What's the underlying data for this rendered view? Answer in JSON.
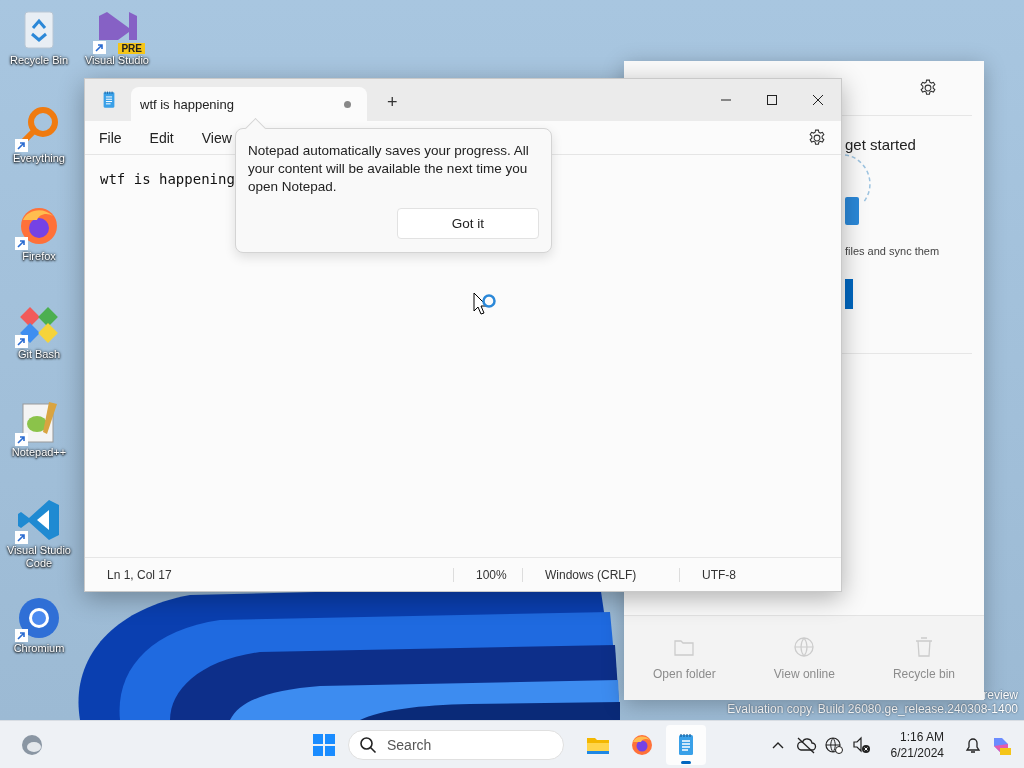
{
  "desktop_icons": [
    {
      "label": "Recycle Bin",
      "kind": "recycle",
      "shortcut": false
    },
    {
      "label": "Everything",
      "kind": "everything",
      "shortcut": true
    },
    {
      "label": "Firefox",
      "kind": "firefox",
      "shortcut": true
    },
    {
      "label": "Git Bash",
      "kind": "git",
      "shortcut": true
    },
    {
      "label": "Notepad++",
      "kind": "notepadpp",
      "shortcut": true
    },
    {
      "label": "Visual Studio Code",
      "kind": "vscode",
      "shortcut": true
    },
    {
      "label": "Chromium",
      "kind": "chromium",
      "shortcut": true
    },
    {
      "label": "Visual Studio",
      "kind": "vs",
      "shortcut": true,
      "badge": "PRE"
    }
  ],
  "system_watermark": [
    "review",
    "Evaluation copy. Build 26080.ge_release.240308-1400"
  ],
  "onedrive_panel": {
    "heading": "get started",
    "description": "files and sync them",
    "actions": [
      {
        "label": "Open folder",
        "kind": "folder",
        "disabled": true
      },
      {
        "label": "View online",
        "kind": "globe",
        "disabled": true
      },
      {
        "label": "Recycle bin",
        "kind": "bin",
        "disabled": true
      }
    ]
  },
  "notepad": {
    "tabs": [
      {
        "title": "wtf is happening",
        "selected": true,
        "unsaved": true
      }
    ],
    "new_tab": "+",
    "menu": [
      "File",
      "Edit",
      "View"
    ],
    "content": "wtf is happening",
    "status": [
      "Ln 1, Col 17",
      "100%",
      "Windows (CRLF)",
      "UTF-8"
    ]
  },
  "teaching_tip": {
    "message": "Notepad automatically saves your progress. All your content will be available the next time you open Notepad.",
    "button": "Got it"
  },
  "taskbar": {
    "search_placeholder": "Search",
    "apps": [
      {
        "kind": "explorer",
        "active": false
      },
      {
        "kind": "firefox",
        "active": false
      },
      {
        "kind": "notepad",
        "active": true
      }
    ],
    "time": "1:16 AM",
    "date": "6/21/2024"
  }
}
